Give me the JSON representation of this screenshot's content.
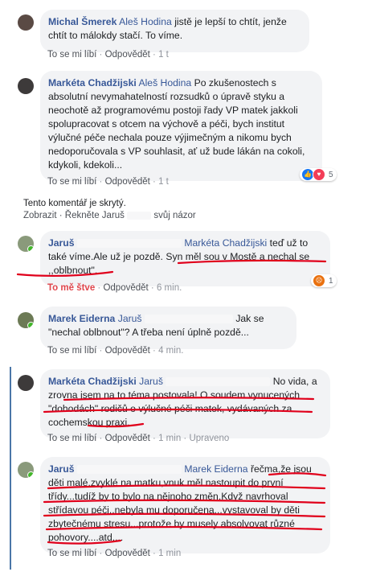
{
  "comments": [
    {
      "author": "Michal Šmerek",
      "mention": "Aleš Hodina",
      "text": "jistě je lepší to chtít, jenže chtít to málokdy stačí. To víme.",
      "like_label": "To se mi líbí",
      "reply_label": "Odpovědět",
      "time": "1 t"
    },
    {
      "author": "Markéta Chadžijski",
      "mention": "Aleš Hodina",
      "text": "Po zkušenostech s absolutní nevymahatelností rozsudků o úpravě styku a neochotě až programovému postoji řady VP matek jakkoli spolupracovat s otcem na výchově a péči, bych institut výlučné péče nechala pouze výjimečným a nikomu bych nedoporučovala s VP souhlasit, ať už bude lákán na cokoli, kdykoli, kdekoli...",
      "like_label": "To se mi líbí",
      "reply_label": "Odpovědět",
      "time": "1 t",
      "reactions": "5",
      "reaction_icons": [
        "like-icon",
        "love-icon"
      ]
    },
    {
      "hidden_text": "Tento komentář je skrytý.",
      "show_label": "Zobrazit",
      "tell_label": "Řekněte Jaruš",
      "opinion_label": "svůj názor"
    },
    {
      "author": "Jaruš",
      "mention": "Markéta Chadžijski",
      "text_a": "teď už to také víme.Ale už je pozdě.",
      "text_b": "Syn měl sou v Mostě a nechal se ,,oblbnout\".",
      "like_label": "To mě štve",
      "reply_label": "Odpovědět",
      "time": "6 min.",
      "reactions": "1",
      "reaction_icons": [
        "angry-icon"
      ]
    },
    {
      "author": "Marek Eiderna",
      "mention": "Jaruš",
      "text": "Jak se \"nechal oblbnout\"? A třeba není úplně pozdě...",
      "like_label": "To se mi líbí",
      "reply_label": "Odpovědět",
      "time": "4 min."
    },
    {
      "author": "Markéta Chadžijski",
      "mention": "Jaruš",
      "text": "No vida, a zrovna jsem na to téma postovala! O soudem vynucených \"dohodách\" rodičů o výlučné péči matek, vydávaných za cochemskou praxi.",
      "like_label": "To se mi líbí",
      "reply_label": "Odpovědět",
      "time": "1 min",
      "edited": "Upraveno"
    },
    {
      "author": "Jaruš",
      "mention": "Marek Eiderna",
      "text": "řečma,že jsou děti malé,zvyklé na matku,vnuk měl nastoupit do první třídy...tudíž by to bylo na nějnoho změn.Když navrhoval střídavou péči..nebyla mu doporučena...vystavoval by děti zbytečnému stresu...protože by musely absolvovat různé pohovory....atd....",
      "like_label": "To se mi líbí",
      "reply_label": "Odpovědět",
      "time": "1 min"
    }
  ],
  "colors": {
    "link": "#385898",
    "bubble": "#f2f3f5",
    "meta": "#90949c",
    "annotation": "#e0001b",
    "thread": "#4a76a8"
  }
}
